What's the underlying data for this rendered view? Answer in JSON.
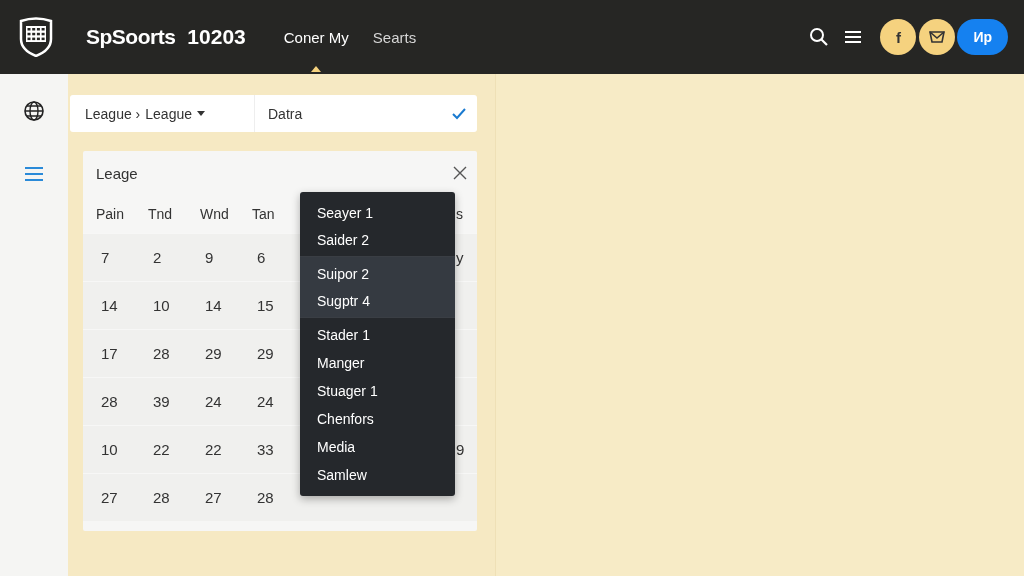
{
  "header": {
    "brand": "SpSoorts",
    "number": "10203",
    "nav": [
      {
        "label": "Coner My",
        "selected": true
      },
      {
        "label": "Searts",
        "selected": false
      }
    ],
    "circle_text": "f",
    "pill_text": "Ир"
  },
  "breadcrumb": {
    "items": [
      "League ›",
      "League"
    ],
    "field_value": "Datra"
  },
  "calendar": {
    "title": "Leage",
    "columns": [
      "Pain",
      "Tnd",
      "Wnd",
      "Tan"
    ],
    "header_edge": "s",
    "rows": [
      {
        "cells": [
          "7",
          "2",
          "9",
          "6"
        ],
        "edge": "y"
      },
      {
        "cells": [
          "14",
          "10",
          "14",
          "15"
        ]
      },
      {
        "cells": [
          "17",
          "28",
          "29",
          "29"
        ]
      },
      {
        "cells": [
          "28",
          "39",
          "24",
          "24"
        ]
      },
      {
        "cells": [
          "10",
          "22",
          "22",
          "33"
        ],
        "edge": "9"
      },
      {
        "cells": [
          "27",
          "28",
          "27",
          "28"
        ]
      }
    ]
  },
  "menu": {
    "groups": [
      {
        "selected": false,
        "items": [
          "Seayer 1",
          "Saider 2"
        ]
      },
      {
        "selected": true,
        "items": [
          "Suipor 2",
          "Sugptr 4"
        ]
      },
      {
        "selected": false,
        "items": [
          "Stader 1",
          "Manger",
          "Stuager 1",
          "Chenfors",
          "Media",
          "Samlew"
        ]
      }
    ]
  }
}
